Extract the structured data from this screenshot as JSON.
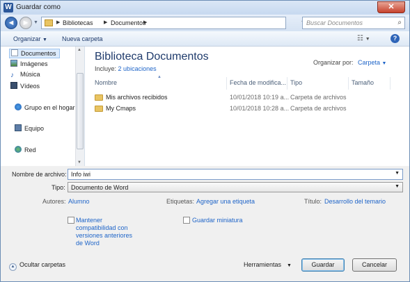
{
  "window": {
    "title": "Guardar como",
    "app_badge": "W",
    "close_glyph": "✕"
  },
  "nav": {
    "back_glyph": "◄",
    "forward_glyph": "►",
    "breadcrumbs": [
      "Bibliotecas",
      "Documentos"
    ],
    "search_placeholder": "Buscar Documentos"
  },
  "toolbar": {
    "organize": "Organizar",
    "new_folder": "Nueva carpeta"
  },
  "sidebar": {
    "items": [
      {
        "label": "Documentos",
        "icon": "documents-icon"
      },
      {
        "label": "Imágenes",
        "icon": "pictures-icon"
      },
      {
        "label": "Música",
        "icon": "music-icon"
      },
      {
        "label": "Vídeos",
        "icon": "videos-icon"
      },
      {
        "label": "Grupo en el hogar",
        "icon": "homegroup-icon"
      },
      {
        "label": "Equipo",
        "icon": "computer-icon"
      },
      {
        "label": "Red",
        "icon": "network-icon"
      }
    ]
  },
  "library": {
    "title": "Biblioteca Documentos",
    "includes_label": "Incluye:",
    "includes_link": "2 ubicaciones",
    "arrange_label": "Organizar por:",
    "arrange_value": "Carpeta"
  },
  "columns": [
    "Nombre",
    "Fecha de modifica...",
    "Tipo",
    "Tamaño"
  ],
  "files": [
    {
      "name": "Mis archivos recibidos",
      "date": "10/01/2018 10:19 a...",
      "type": "Carpeta de archivos",
      "size": ""
    },
    {
      "name": "My Cmaps",
      "date": "10/01/2018 10:28 a...",
      "type": "Carpeta de archivos",
      "size": ""
    }
  ],
  "form": {
    "filename_label": "Nombre de archivo:",
    "filename_value": "Info iwi",
    "type_label": "Tipo:",
    "type_value": "Documento de Word",
    "authors_label": "Autores:",
    "authors_value": "Alumno",
    "tags_label": "Etiquetas:",
    "tags_value": "Agregar una etiqueta",
    "title_label": "Título:",
    "title_value": "Desarrollo del temario",
    "compat_line1": "Mantener",
    "compat_line2": "compatibilidad con",
    "compat_line3": "versiones anteriores",
    "compat_line4": "de Word",
    "thumbnail_label": "Guardar miniatura"
  },
  "footer": {
    "hide_folders": "Ocultar carpetas",
    "tools": "Herramientas",
    "save": "Guardar",
    "cancel": "Cancelar"
  },
  "colors": {
    "accent": "#1e64c8",
    "title": "#1e3a6b",
    "folder": "#e9c462"
  }
}
